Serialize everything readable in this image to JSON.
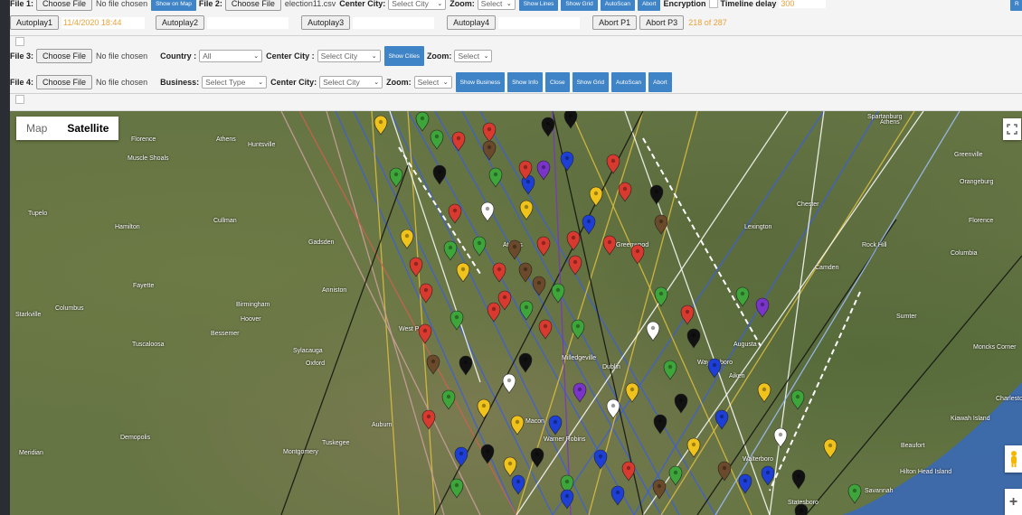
{
  "row1": {
    "file1_label": "File 1:",
    "file1_button": "Choose File",
    "file1_status": "No file chosen",
    "show_on_map": "Show on Map",
    "file2_label": "File 2:",
    "file2_button": "Choose File",
    "file2_name": "election11.csv",
    "center_city_label": "Center City:",
    "center_city_value": "Select City",
    "zoom_label": "Zoom:",
    "zoom_value": "Select",
    "show_lines": "Show Lines",
    "show_grid": "Show Grid",
    "autoscan": "AutoScan",
    "abort": "Abort",
    "encryption_label": "Encryption",
    "timeline_label": "Timeline delay",
    "timeline_value": "300",
    "right_btn": "R"
  },
  "row2": {
    "autoplay1": "Autoplay1",
    "autoplay1_date": "11/4/2020 18:44",
    "autoplay2": "Autoplay2",
    "autoplay3": "Autoplay3",
    "autoplay4": "Autoplay4",
    "abort_p1": "Abort P1",
    "abort_p3": "Abort P3",
    "progress": "218 of 287"
  },
  "row3": {
    "file3_label": "File 3:",
    "file3_button": "Choose File",
    "file3_status": "No file chosen",
    "country_label": "Country :",
    "country_value": "All",
    "center_city_label": "Center City :",
    "center_city_value": "Select City",
    "show_cities": "Show Cities",
    "zoom_label": "Zoom:",
    "zoom_value": "Select"
  },
  "row4": {
    "file4_label": "File 4:",
    "file4_button": "Choose File",
    "file4_status": "No file chosen",
    "business_label": "Business:",
    "business_value": "Select Type",
    "center_city_label": "Center City:",
    "center_city_value": "Select City",
    "zoom_label": "Zoom:",
    "zoom_value": "Select",
    "show_business": "Show Business",
    "show_info": "Show Info",
    "close": "Close",
    "show_grid": "Show Grid",
    "autoscan": "AutoScan",
    "abort": "Abort"
  },
  "map": {
    "type_map": "Map",
    "type_satellite": "Satellite",
    "zoom_in": "+",
    "cities": [
      "Huntsville",
      "Athens",
      "Florence",
      "Muscle Shoals",
      "Cullman",
      "Gadsden",
      "Birmingham",
      "Hoover",
      "Bessemer",
      "Tuscaloosa",
      "Anniston",
      "Sylacauga",
      "Auburn",
      "Columbus",
      "Montgomery",
      "Tuskegee",
      "Meridian",
      "Demopolis",
      "Starkville",
      "Tupelo",
      "Hamilton",
      "Fayette",
      "Athens",
      "Greenville",
      "Spartanburg",
      "Rock Hill",
      "Columbia",
      "Sumter",
      "Orangeburg",
      "Florence",
      "Charleston",
      "Moncks Corner",
      "Kiawah Island",
      "Hilton Head Island",
      "Beaufort",
      "Savannah",
      "Augusta",
      "Aiken",
      "Waynesboro",
      "Statesboro",
      "Walterboro",
      "Macon",
      "Warner Robins",
      "Milledgeville",
      "Dublin",
      "Athens",
      "Lexington",
      "Camden",
      "Chester",
      "Greenwood",
      "West Point",
      "Oxford"
    ],
    "colors": {
      "red": "#d93a2f",
      "green": "#3ea53a",
      "yellow": "#f0c21c",
      "blue": "#1e3fd6",
      "black": "#111111",
      "purple": "#7a34c9",
      "brown": "#6b4a2b",
      "white": "#ffffff"
    }
  }
}
